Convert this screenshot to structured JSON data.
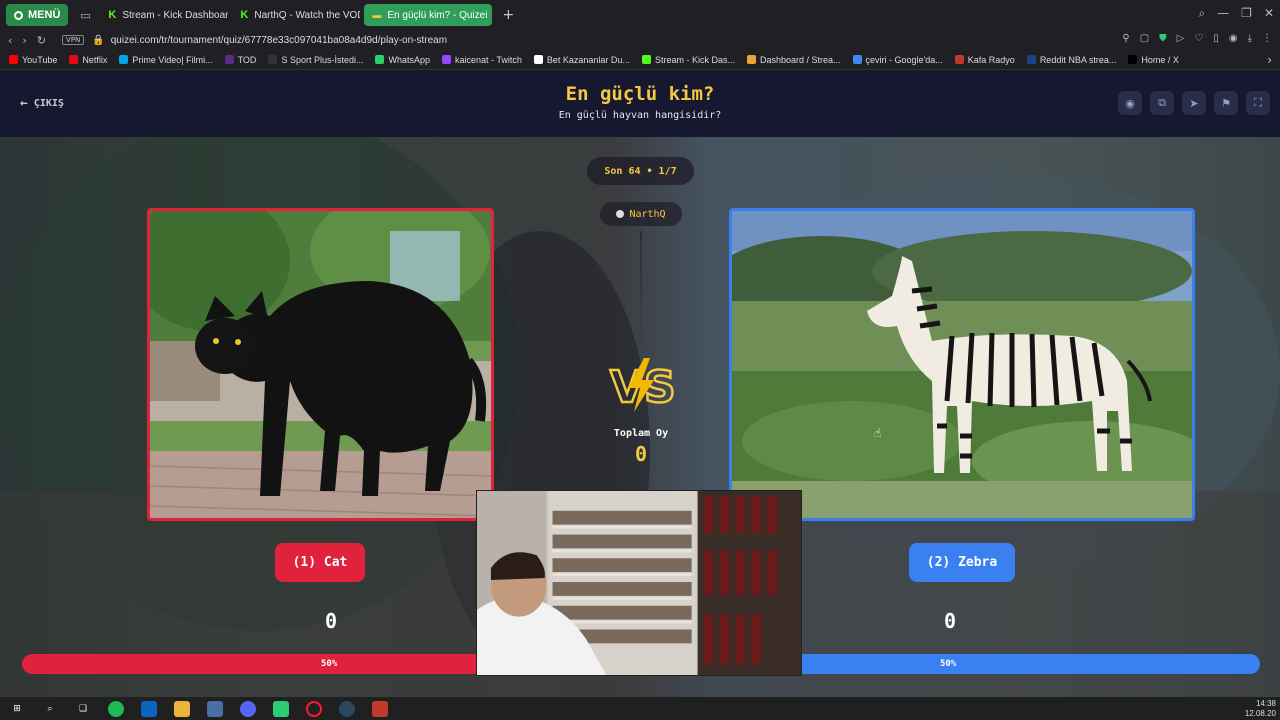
{
  "browser": {
    "menu_label": "MENÜ",
    "tabs": [
      {
        "label": "Stream - Kick Dashboard",
        "icon": "kick-icon"
      },
      {
        "label": "NarthQ - Watch the VOD",
        "icon": "kick-icon"
      },
      {
        "label": "En güçlü kim? - Quizei",
        "icon": "quizei-icon",
        "active": true
      }
    ],
    "vpn_label": "VPN",
    "url": "quizei.com/tr/tournament/quiz/67778e33c097041ba08a4d9d/play-on-stream",
    "bookmarks": [
      {
        "label": "YouTube",
        "color": "#ff0000"
      },
      {
        "label": "Netflix",
        "color": "#e50914"
      },
      {
        "label": "Prime Video| Filmi...",
        "color": "#00a8e1"
      },
      {
        "label": "TOD",
        "color": "#5b2a86"
      },
      {
        "label": "S Sport Plus-İstedi...",
        "color": "#333333"
      },
      {
        "label": "WhatsApp",
        "color": "#25d366"
      },
      {
        "label": "kaicenat - Twitch",
        "color": "#9146ff"
      },
      {
        "label": "Bet Kazananlar Du...",
        "color": "#ffffff"
      },
      {
        "label": "Stream - Kick Das...",
        "color": "#53fc18"
      },
      {
        "label": "Dashboard / Strea...",
        "color": "#e8a33a"
      },
      {
        "label": "çeviri - Google'da...",
        "color": "#4285f4"
      },
      {
        "label": "Kafa Radyo",
        "color": "#c0392b"
      },
      {
        "label": "Reddit NBA strea...",
        "color": "#1d428a"
      },
      {
        "label": "Home / X",
        "color": "#000000"
      }
    ]
  },
  "quiz": {
    "back_label": "ÇIKIŞ",
    "title": "En güçlü kim?",
    "subtitle": "En güçlü hayvan hangisidir?",
    "round": "Son 64 • 1/7",
    "streamer": "NarthQ",
    "total_votes_label": "Toplam Oy",
    "total_votes": "0",
    "left": {
      "label": "(1) Cat",
      "votes": "0",
      "percent": "50%",
      "color": "#e0223c"
    },
    "right": {
      "label": "(2) Zebra",
      "votes": "0",
      "percent": "50%",
      "color": "#3a80f0"
    },
    "vs_text": "VS"
  },
  "taskbar": {
    "time": "14:38",
    "date": "12.08.20"
  }
}
